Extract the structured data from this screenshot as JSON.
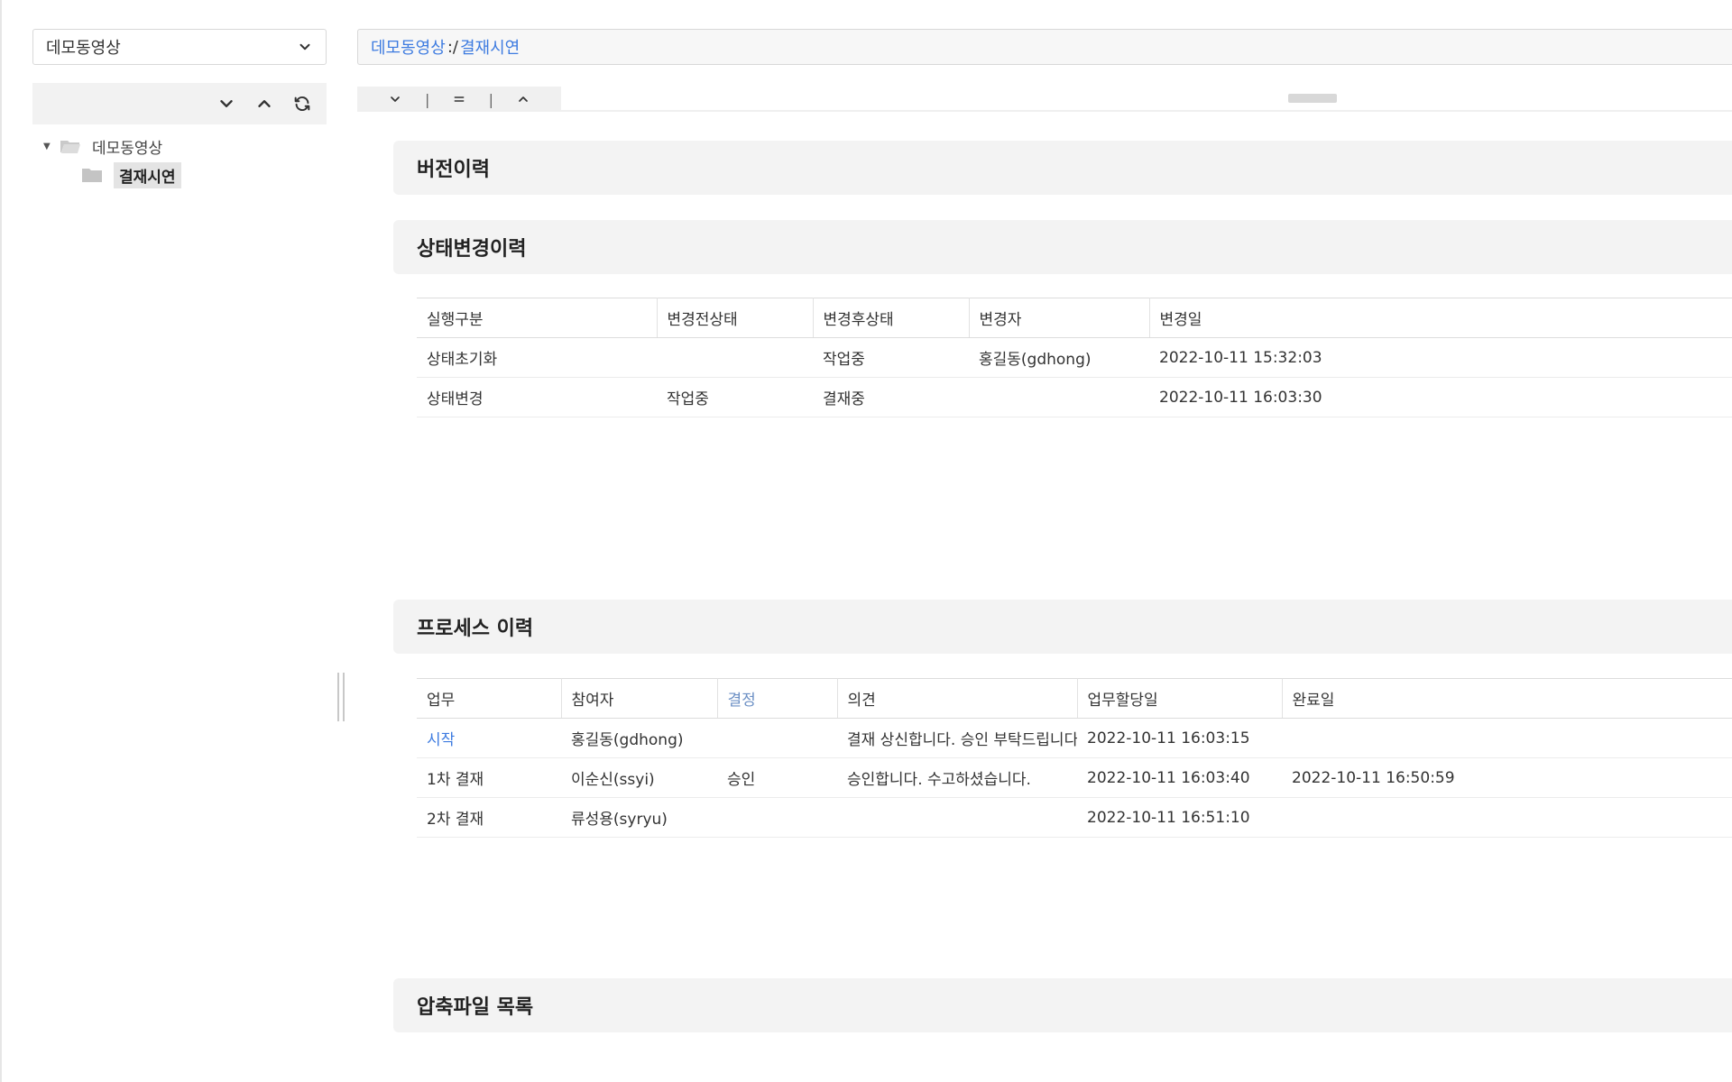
{
  "sidebar": {
    "project_select": {
      "value": "데모동영상"
    },
    "toolbar": {
      "icons": [
        "chevron-down-icon",
        "chevron-up-icon",
        "refresh-icon"
      ]
    },
    "tree": {
      "root": {
        "label": "데모동영상"
      },
      "children": [
        {
          "label": "결재시연",
          "selected": true
        }
      ]
    }
  },
  "path": {
    "segments": [
      "데모동영상",
      "결재시연"
    ],
    "separator": ":/"
  },
  "view_toolbar": {
    "dividers": [
      "|",
      "|"
    ]
  },
  "sections": {
    "version_history": {
      "title": "버전이력"
    },
    "status_history": {
      "title": "상태변경이력",
      "columns": [
        "실행구분",
        "변경전상태",
        "변경후상태",
        "변경자",
        "변경일"
      ],
      "rows": [
        [
          "상태초기화",
          "",
          "작업중",
          "홍길동(gdhong)",
          "2022-10-11 15:32:03"
        ],
        [
          "상태변경",
          "작업중",
          "결재중",
          "",
          "2022-10-11 16:03:30"
        ]
      ]
    },
    "process_history": {
      "title": "프로세스 이력",
      "columns": [
        "업무",
        "참여자",
        "결정",
        "의견",
        "업무할당일",
        "완료일"
      ],
      "rows": [
        [
          "시작",
          "홍길동(gdhong)",
          "",
          "결재 상신합니다. 승인 부탁드립니다",
          "2022-10-11 16:03:15",
          ""
        ],
        [
          "1차 결재",
          "이순신(ssyi)",
          "승인",
          "승인합니다. 수고하셨습니다.",
          "2022-10-11 16:03:40",
          "2022-10-11 16:50:59"
        ],
        [
          "2차 결재",
          "류성용(syryu)",
          "",
          "",
          "2022-10-11 16:51:10",
          ""
        ]
      ]
    },
    "archive_list": {
      "title": "압축파일 목록"
    }
  },
  "colors": {
    "link": "#3d7be0",
    "section_bg": "#f3f3f3",
    "toolbar_bg": "#f2f2f2"
  }
}
